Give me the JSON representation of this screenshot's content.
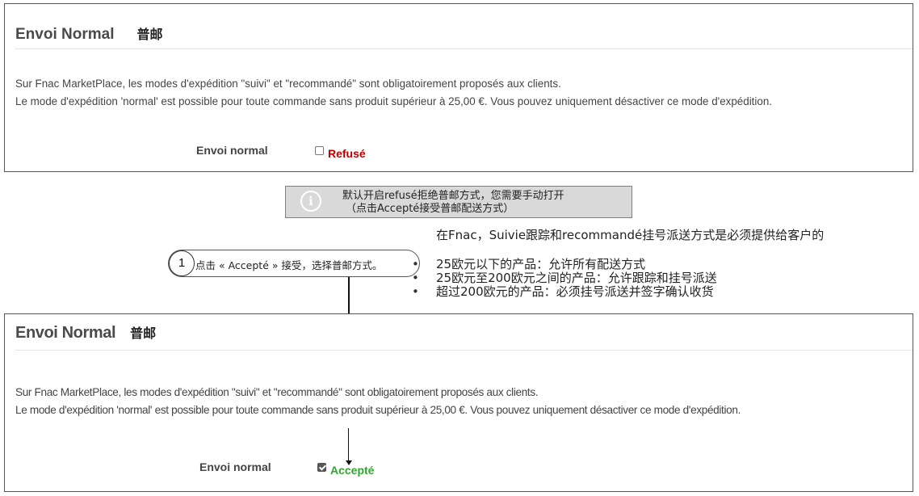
{
  "panel_top": {
    "title": "Envoi Normal",
    "title_cn": "普邮",
    "desc_line1": "Sur Fnac MarketPlace, les modes d'expédition \"suivi\" et \"recommandé\" sont obligatoirement proposés aux clients.",
    "desc_line2": "Le mode d'expédition 'normal' est possible pour toute commande sans produit supérieur à 25,00 €. Vous pouvez uniquement désactiver ce mode d'expédition.",
    "field_label": "Envoi normal",
    "checkbox_checked": false,
    "status": "Refusé",
    "status_color": "#c00000"
  },
  "info_box": {
    "icon": "info-icon",
    "icon_glyph": "i",
    "line1": "默认开启refusé拒绝普邮方式，您需要手动打开",
    "line2": "（点击Accepté接受普邮配送方式）"
  },
  "step": {
    "number": "1",
    "text": "点击 « Accepté » 接受，选择普邮方式。"
  },
  "notes": {
    "heading": "在Fnac，Suivie跟踪和recommandé挂号派送方式是必须提供给客户的",
    "items": [
      "25欧元以下的产品：允许所有配送方式",
      "25欧元至200欧元之间的产品：允许跟踪和挂号派送",
      "超过200欧元的产品：必须挂号派送并签字确认收货"
    ]
  },
  "panel_bottom": {
    "title": "Envoi Normal",
    "title_cn": "普邮",
    "desc_line1": "Sur Fnac MarketPlace, les modes d'expédition \"suivi\" et \"recommandé\" sont obligatoirement proposés aux clients.",
    "desc_line2": "Le mode d'expédition 'normal' est possible pour toute commande sans produit supérieur à 25,00 €. Vous pouvez uniquement désactiver ce mode d'expédition.",
    "field_label": "Envoi normal",
    "checkbox_checked": true,
    "status": "Accepté",
    "status_color": "#2da82d"
  }
}
